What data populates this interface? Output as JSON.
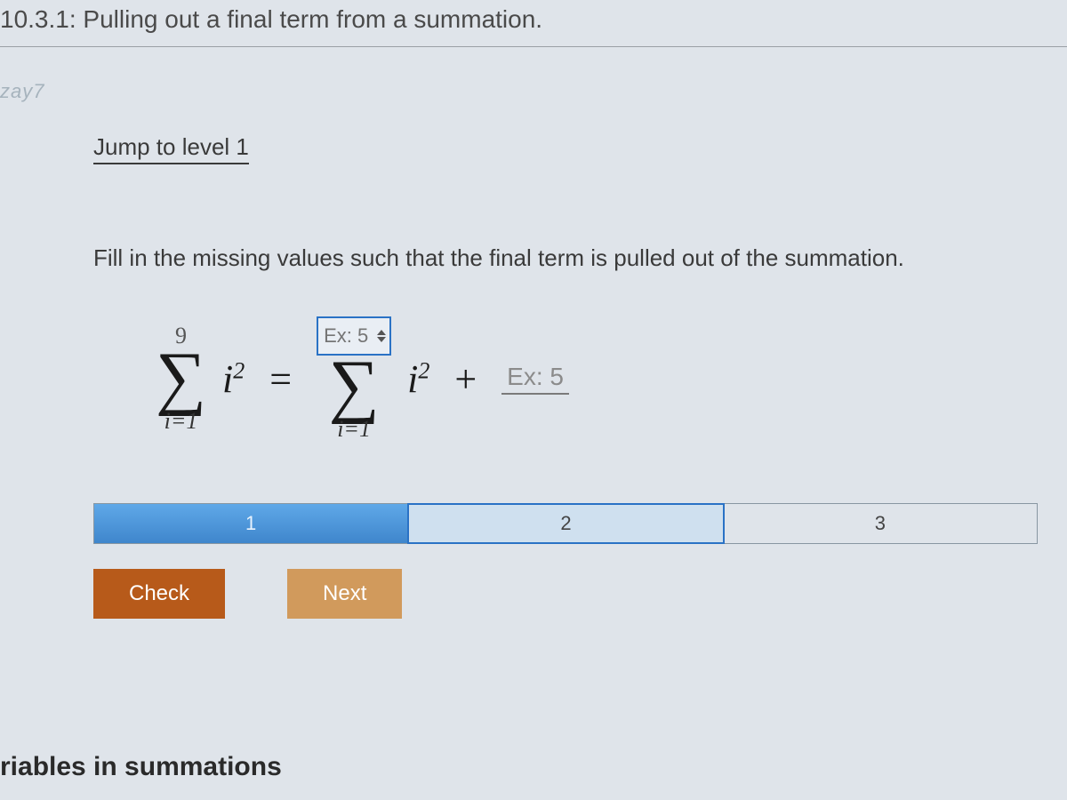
{
  "header": {
    "title": "10.3.1: Pulling out a final term from a summation."
  },
  "watermark": "zay7",
  "jump_link": "Jump to level 1",
  "instruction": "Fill in the missing values such that the final term is pulled out of the summation.",
  "equation": {
    "left_sum": {
      "upper": "9",
      "lower": "i=1",
      "term_base": "i",
      "term_exp": "2"
    },
    "equals": "=",
    "right_sum": {
      "upper_placeholder": "Ex: 5",
      "lower": "i=1",
      "term_base": "i",
      "term_exp": "2"
    },
    "plus": "+",
    "trailing_placeholder": "Ex: 5"
  },
  "progress": {
    "segments": [
      {
        "label": "1",
        "state": "active"
      },
      {
        "label": "2",
        "state": "current"
      },
      {
        "label": "3",
        "state": ""
      }
    ]
  },
  "buttons": {
    "check": "Check",
    "next": "Next"
  },
  "footer_fragment": "riables in summations"
}
